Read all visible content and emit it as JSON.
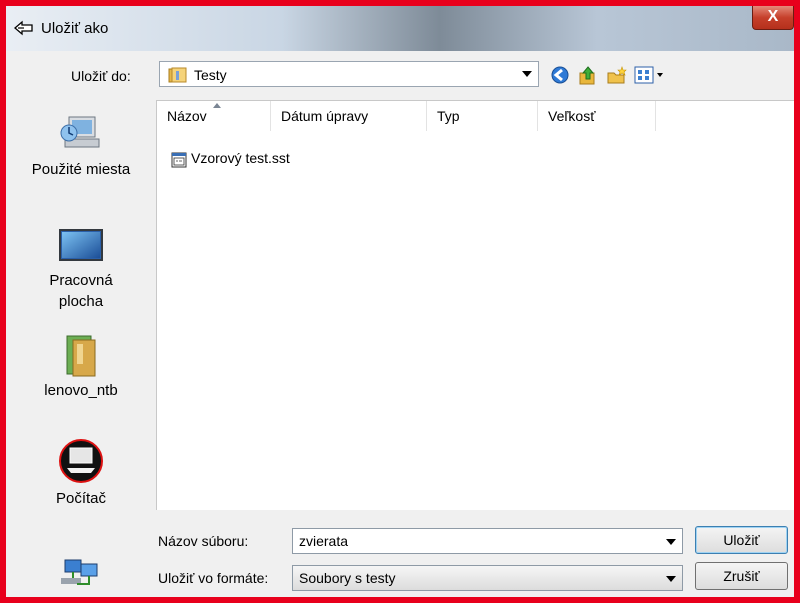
{
  "window": {
    "title": "Uložiť ako",
    "close_label": "X"
  },
  "toolbar": {
    "save_in_label": "Uložiť do:",
    "location": "Testy",
    "icons": [
      "back-icon",
      "up-folder-icon",
      "new-folder-icon",
      "view-menu-icon"
    ]
  },
  "places": [
    {
      "label": "Použité miesta",
      "icon": "recent-places-icon"
    },
    {
      "label": "Pracovná plocha",
      "icon": "desktop-icon"
    },
    {
      "label": "lenovo_ntb",
      "icon": "user-folder-icon"
    },
    {
      "label": "Počítač",
      "icon": "computer-icon"
    },
    {
      "label": "",
      "icon": "network-icon"
    }
  ],
  "filelist": {
    "columns": [
      "Názov",
      "Dátum úpravy",
      "Typ",
      "Veľkosť"
    ],
    "sorted_column": "Názov",
    "files": [
      {
        "name": "Vzorový test.sst",
        "icon": "sst-file-icon"
      }
    ]
  },
  "form": {
    "filename_label": "Názov súboru:",
    "filename_value": "zvierata",
    "format_label": "Uložiť vo formáte:",
    "format_value": "Soubory s testy"
  },
  "buttons": {
    "save": "Uložiť",
    "cancel": "Zrušiť"
  },
  "colors": {
    "outer_border": "#e8001c",
    "dialog_bg": "#f0f0f0",
    "close_button": "#c6402b"
  }
}
